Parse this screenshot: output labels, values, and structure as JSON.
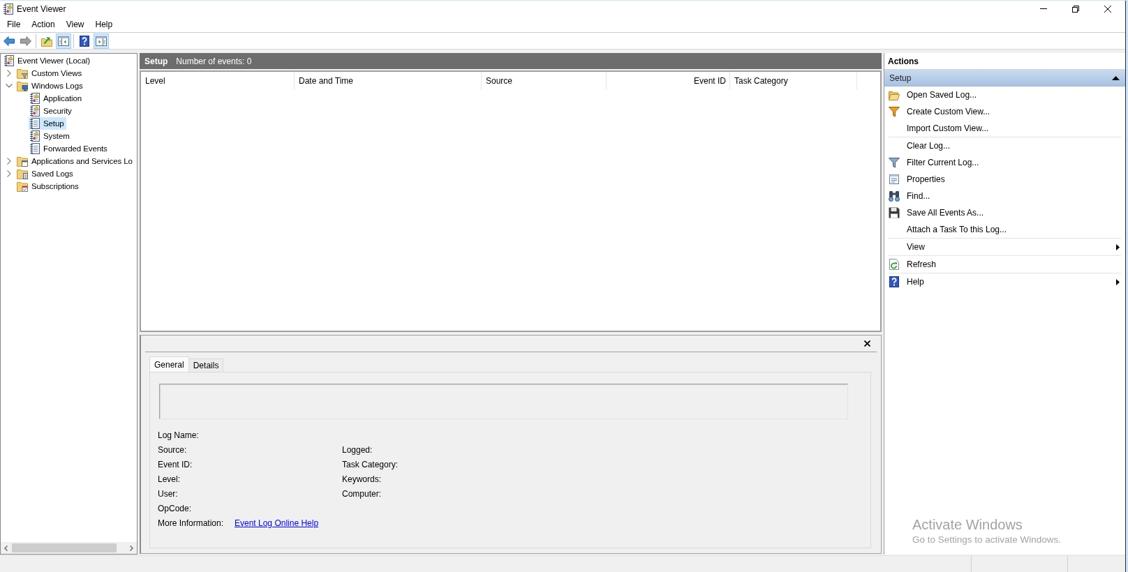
{
  "window": {
    "title": "Event Viewer"
  },
  "menu": [
    "File",
    "Action",
    "View",
    "Help"
  ],
  "toolbar": {
    "groups": [
      [
        {
          "kind": "back",
          "pressed": false,
          "disabled": false
        },
        {
          "kind": "forward",
          "pressed": false,
          "disabled": true
        }
      ],
      [
        {
          "kind": "up",
          "pressed": false,
          "disabled": false
        },
        {
          "kind": "tree",
          "pressed": true,
          "disabled": false
        }
      ],
      [
        {
          "kind": "help",
          "pressed": false,
          "disabled": false
        },
        {
          "kind": "actions",
          "pressed": true,
          "disabled": false
        }
      ]
    ]
  },
  "tree": {
    "items": [
      {
        "label": "Event Viewer (Local)",
        "kind": "root",
        "selected": false,
        "children": [
          {
            "label": "Custom Views",
            "kind": "views",
            "expanded": false,
            "selected": false
          },
          {
            "label": "Windows Logs",
            "kind": "logs",
            "expanded": true,
            "selected": false,
            "children": [
              {
                "label": "Application",
                "kind": "alertlog",
                "selected": false
              },
              {
                "label": "Security",
                "kind": "alertlog",
                "selected": false
              },
              {
                "label": "Setup",
                "kind": "log",
                "selected": true
              },
              {
                "label": "System",
                "kind": "alertlog",
                "selected": false
              },
              {
                "label": "Forwarded Events",
                "kind": "log",
                "selected": false
              }
            ]
          },
          {
            "label": "Applications and Services Lo",
            "kind": "services",
            "expanded": false,
            "selected": false
          },
          {
            "label": "Saved Logs",
            "kind": "saved",
            "expanded": false,
            "selected": false
          },
          {
            "label": "Subscriptions",
            "kind": "subscriptions",
            "selected": false
          }
        ]
      }
    ]
  },
  "event_list": {
    "title": "Setup",
    "count": "Number of events: 0",
    "columns": [
      "Level",
      "Date and Time",
      "Source",
      "Event ID",
      "Task Category"
    ]
  },
  "details": {
    "tabs": [
      {
        "label": "General",
        "selected": true
      },
      {
        "label": "Details",
        "selected": false
      }
    ],
    "fields": [
      {
        "left": "Log Name:"
      },
      {
        "left": "Source:",
        "right": "Logged:"
      },
      {
        "left": "Event ID:",
        "right": "Task Category:"
      },
      {
        "left": "Level:",
        "right": "Keywords:"
      },
      {
        "left": "User:",
        "right": "Computer:"
      },
      {
        "left": "OpCode:"
      }
    ],
    "more_information": {
      "label": "More Information:",
      "link": "Event Log Online Help"
    }
  },
  "actions": {
    "title": "Actions",
    "section": {
      "title": "Setup",
      "expanded": true
    },
    "groups": [
      [
        {
          "label": "Open Saved Log...",
          "kind": "open",
          "submenu": false
        },
        {
          "label": "Create Custom View...",
          "kind": "create",
          "submenu": false
        },
        {
          "label": "Import Custom View...",
          "kind": "plain",
          "submenu": false
        }
      ],
      [
        {
          "label": "Clear Log...",
          "kind": "plain",
          "submenu": false
        },
        {
          "label": "Filter Current Log...",
          "kind": "filter",
          "submenu": false
        },
        {
          "label": "Properties",
          "kind": "properties",
          "submenu": false
        },
        {
          "label": "Find...",
          "kind": "find",
          "submenu": false
        },
        {
          "label": "Save All Events As...",
          "kind": "save",
          "submenu": false
        },
        {
          "label": "Attach a Task To this Log...",
          "kind": "plain",
          "submenu": false
        }
      ],
      [
        {
          "label": "View",
          "kind": "plain",
          "submenu": true
        }
      ],
      [
        {
          "label": "Refresh",
          "kind": "refresh",
          "submenu": false
        }
      ],
      [
        {
          "label": "Help",
          "kind": "help",
          "submenu": true
        }
      ]
    ]
  },
  "activation_notice": {
    "title": "Activate Windows",
    "subtitle": "Go to Settings to activate Windows."
  }
}
